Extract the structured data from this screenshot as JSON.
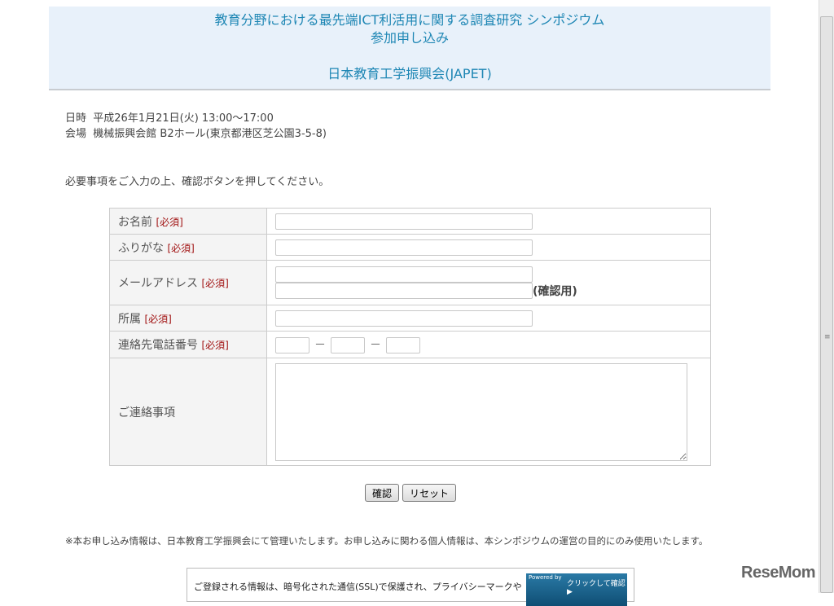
{
  "header": {
    "title_line1": "教育分野における最先端ICT利活用に関する調査研究 シンポジウム",
    "title_line2": "参加申し込み",
    "organization": "日本教育工学振興会(JAPET)"
  },
  "event": {
    "date_label": "日時",
    "date_value": "平成26年1月21日(火) 13:00～17:00",
    "venue_label": "会場",
    "venue_value": "機械振興会館 B2ホール(東京都港区芝公園3-5-8)"
  },
  "instruction": "必要事項をご入力の上、確認ボタンを押してください。",
  "form": {
    "required_tag": "[必須]",
    "name_label": "お名前",
    "name_value": "",
    "furigana_label": "ふりがな",
    "furigana_value": "",
    "email_label": "メールアドレス",
    "email_value": "",
    "email_confirm_value": "",
    "email_confirm_note": "(確認用)",
    "affiliation_label": "所属",
    "affiliation_value": "",
    "phone_label": "連絡先電話番号",
    "phone_separator": "－",
    "phone1": "",
    "phone2": "",
    "phone3": "",
    "message_label": "ご連絡事項",
    "message_value": ""
  },
  "buttons": {
    "confirm": "確認",
    "reset": "リセット"
  },
  "privacy_note": "※本お申し込み情報は、日本教育工学振興会にて管理いたします。お申し込みに関わる個人情報は、本シンポジウムの運営の目的にのみ使用いたします。",
  "ssl": {
    "text": "ご登録される情報は、暗号化された通信(SSL)で保護され、プライバシーマークや",
    "badge_powered": "Powered by",
    "badge_label": "クリックして確認 ▶"
  },
  "watermark": "ReseMom"
}
